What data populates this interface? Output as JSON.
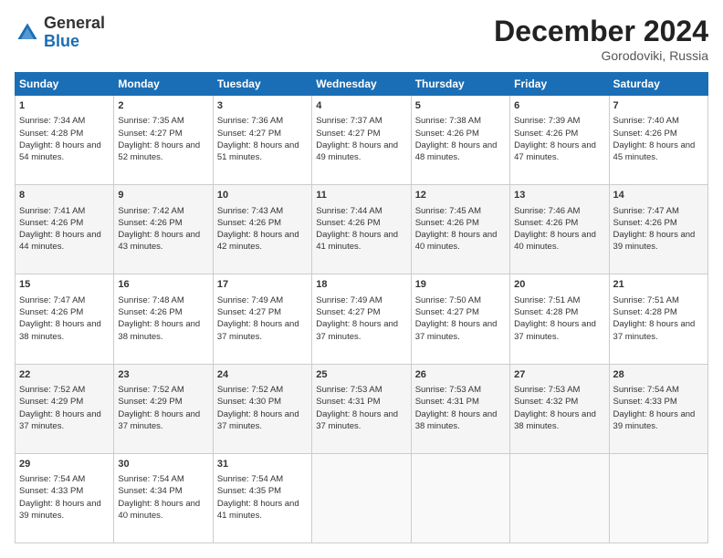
{
  "logo": {
    "general": "General",
    "blue": "Blue"
  },
  "header": {
    "month": "December 2024",
    "location": "Gorodoviki, Russia"
  },
  "days": [
    "Sunday",
    "Monday",
    "Tuesday",
    "Wednesday",
    "Thursday",
    "Friday",
    "Saturday"
  ],
  "weeks": [
    [
      {
        "day": "1",
        "sunrise": "7:34 AM",
        "sunset": "4:28 PM",
        "daylight": "8 hours and 54 minutes."
      },
      {
        "day": "2",
        "sunrise": "7:35 AM",
        "sunset": "4:27 PM",
        "daylight": "8 hours and 52 minutes."
      },
      {
        "day": "3",
        "sunrise": "7:36 AM",
        "sunset": "4:27 PM",
        "daylight": "8 hours and 51 minutes."
      },
      {
        "day": "4",
        "sunrise": "7:37 AM",
        "sunset": "4:27 PM",
        "daylight": "8 hours and 49 minutes."
      },
      {
        "day": "5",
        "sunrise": "7:38 AM",
        "sunset": "4:26 PM",
        "daylight": "8 hours and 48 minutes."
      },
      {
        "day": "6",
        "sunrise": "7:39 AM",
        "sunset": "4:26 PM",
        "daylight": "8 hours and 47 minutes."
      },
      {
        "day": "7",
        "sunrise": "7:40 AM",
        "sunset": "4:26 PM",
        "daylight": "8 hours and 45 minutes."
      }
    ],
    [
      {
        "day": "8",
        "sunrise": "7:41 AM",
        "sunset": "4:26 PM",
        "daylight": "8 hours and 44 minutes."
      },
      {
        "day": "9",
        "sunrise": "7:42 AM",
        "sunset": "4:26 PM",
        "daylight": "8 hours and 43 minutes."
      },
      {
        "day": "10",
        "sunrise": "7:43 AM",
        "sunset": "4:26 PM",
        "daylight": "8 hours and 42 minutes."
      },
      {
        "day": "11",
        "sunrise": "7:44 AM",
        "sunset": "4:26 PM",
        "daylight": "8 hours and 41 minutes."
      },
      {
        "day": "12",
        "sunrise": "7:45 AM",
        "sunset": "4:26 PM",
        "daylight": "8 hours and 40 minutes."
      },
      {
        "day": "13",
        "sunrise": "7:46 AM",
        "sunset": "4:26 PM",
        "daylight": "8 hours and 40 minutes."
      },
      {
        "day": "14",
        "sunrise": "7:47 AM",
        "sunset": "4:26 PM",
        "daylight": "8 hours and 39 minutes."
      }
    ],
    [
      {
        "day": "15",
        "sunrise": "7:47 AM",
        "sunset": "4:26 PM",
        "daylight": "8 hours and 38 minutes."
      },
      {
        "day": "16",
        "sunrise": "7:48 AM",
        "sunset": "4:26 PM",
        "daylight": "8 hours and 38 minutes."
      },
      {
        "day": "17",
        "sunrise": "7:49 AM",
        "sunset": "4:27 PM",
        "daylight": "8 hours and 37 minutes."
      },
      {
        "day": "18",
        "sunrise": "7:49 AM",
        "sunset": "4:27 PM",
        "daylight": "8 hours and 37 minutes."
      },
      {
        "day": "19",
        "sunrise": "7:50 AM",
        "sunset": "4:27 PM",
        "daylight": "8 hours and 37 minutes."
      },
      {
        "day": "20",
        "sunrise": "7:51 AM",
        "sunset": "4:28 PM",
        "daylight": "8 hours and 37 minutes."
      },
      {
        "day": "21",
        "sunrise": "7:51 AM",
        "sunset": "4:28 PM",
        "daylight": "8 hours and 37 minutes."
      }
    ],
    [
      {
        "day": "22",
        "sunrise": "7:52 AM",
        "sunset": "4:29 PM",
        "daylight": "8 hours and 37 minutes."
      },
      {
        "day": "23",
        "sunrise": "7:52 AM",
        "sunset": "4:29 PM",
        "daylight": "8 hours and 37 minutes."
      },
      {
        "day": "24",
        "sunrise": "7:52 AM",
        "sunset": "4:30 PM",
        "daylight": "8 hours and 37 minutes."
      },
      {
        "day": "25",
        "sunrise": "7:53 AM",
        "sunset": "4:31 PM",
        "daylight": "8 hours and 37 minutes."
      },
      {
        "day": "26",
        "sunrise": "7:53 AM",
        "sunset": "4:31 PM",
        "daylight": "8 hours and 38 minutes."
      },
      {
        "day": "27",
        "sunrise": "7:53 AM",
        "sunset": "4:32 PM",
        "daylight": "8 hours and 38 minutes."
      },
      {
        "day": "28",
        "sunrise": "7:54 AM",
        "sunset": "4:33 PM",
        "daylight": "8 hours and 39 minutes."
      }
    ],
    [
      {
        "day": "29",
        "sunrise": "7:54 AM",
        "sunset": "4:33 PM",
        "daylight": "8 hours and 39 minutes."
      },
      {
        "day": "30",
        "sunrise": "7:54 AM",
        "sunset": "4:34 PM",
        "daylight": "8 hours and 40 minutes."
      },
      {
        "day": "31",
        "sunrise": "7:54 AM",
        "sunset": "4:35 PM",
        "daylight": "8 hours and 41 minutes."
      },
      null,
      null,
      null,
      null
    ]
  ],
  "labels": {
    "sunrise": "Sunrise:",
    "sunset": "Sunset:",
    "daylight": "Daylight:"
  }
}
